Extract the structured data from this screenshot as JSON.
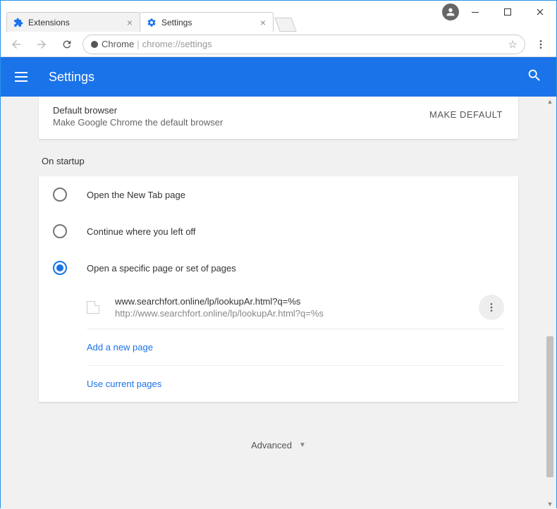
{
  "window": {
    "tabs": [
      {
        "label": "Extensions",
        "icon": "puzzle"
      },
      {
        "label": "Settings",
        "icon": "gear"
      }
    ]
  },
  "toolbar": {
    "protocol_label": "Chrome",
    "url_display": "chrome://settings"
  },
  "settings_header": {
    "title": "Settings"
  },
  "default_browser_card": {
    "heading": "Default browser",
    "subtext": "Make Google Chrome the default browser",
    "button_label": "MAKE DEFAULT"
  },
  "on_startup": {
    "section_label": "On startup",
    "options": [
      {
        "label": "Open the New Tab page",
        "selected": false
      },
      {
        "label": "Continue where you left off",
        "selected": false
      },
      {
        "label": "Open a specific page or set of pages",
        "selected": true
      }
    ],
    "pages": [
      {
        "title": "www.searchfort.online/lp/lookupAr.html?q=%s",
        "url": "http://www.searchfort.online/lp/lookupAr.html?q=%s"
      }
    ],
    "add_page_label": "Add a new page",
    "use_current_label": "Use current pages"
  },
  "advanced_label": "Advanced"
}
